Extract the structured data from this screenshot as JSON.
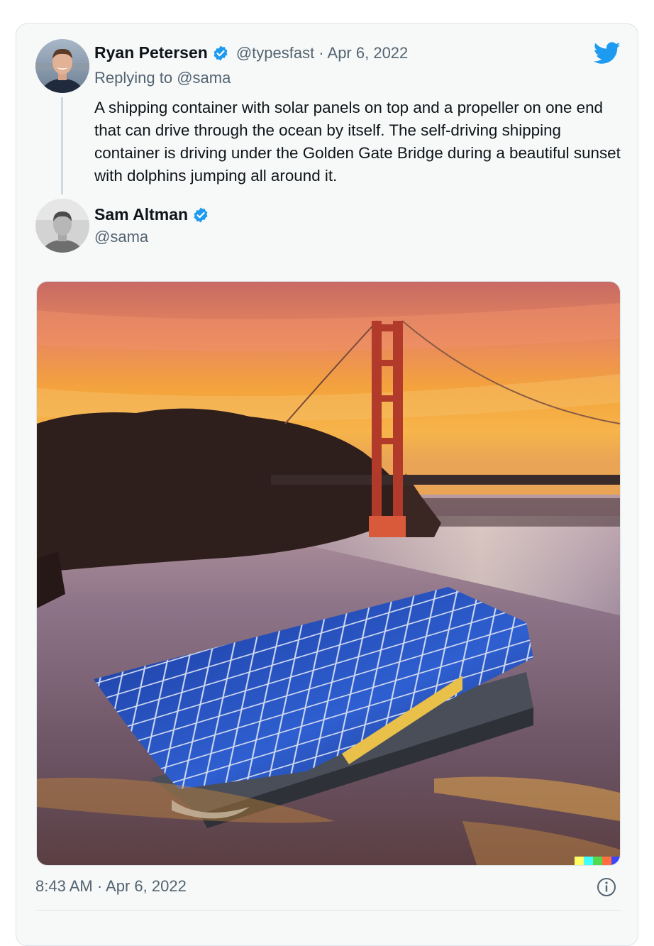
{
  "reply_tweet": {
    "display_name": "Ryan Petersen",
    "handle_meta": "@typesfast · Apr 6, 2022",
    "replying_to_prefix": "Replying to ",
    "replying_to_handle": "@sama",
    "text": "A shipping container with solar panels on top and a propeller on one end that can drive through the ocean by itself. The self-driving shipping container is driving under the Golden Gate Bridge during a beautiful sunset with dolphins jumping all around it."
  },
  "main_tweet": {
    "display_name": "Sam Altman",
    "handle": "@sama",
    "timestamp": "8:43 AM · Apr 6, 2022"
  },
  "icons": {
    "verified": "verified-badge-icon",
    "brand": "twitter-bird-icon",
    "info": "info-icon"
  },
  "colors": {
    "brand_blue": "#1d9bf0",
    "secondary_text": "#536471",
    "card_background": "#f7f9f9"
  }
}
